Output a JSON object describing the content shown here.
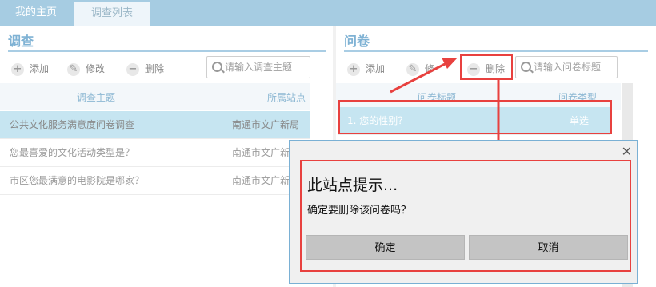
{
  "tabs": [
    {
      "label": "我的主页"
    },
    {
      "label": "调查列表"
    }
  ],
  "left": {
    "title": "调查",
    "toolbar": {
      "add": "添加",
      "edit": "修改",
      "delete": "删除"
    },
    "search": {
      "placeholder": "请输入调查主题"
    },
    "columns": [
      "调查主题",
      "所属站点"
    ],
    "rows": [
      {
        "subject": "公共文化服务满意度问卷调查",
        "site": "南通市文广新局"
      },
      {
        "subject": "您最喜爱的文化活动类型是？",
        "site": "南通市文广新局"
      },
      {
        "subject": "市区您最满意的电影院是哪家？",
        "site": "南通市文广新局"
      }
    ]
  },
  "right": {
    "title": "问卷",
    "toolbar": {
      "add": "添加",
      "edit": "修改",
      "delete": "删除"
    },
    "search": {
      "placeholder": "请输入问卷标题"
    },
    "columns": [
      "问卷标题",
      "问卷类型"
    ],
    "rows": [
      {
        "title": "1. 您的性别？",
        "type": "单选"
      }
    ]
  },
  "dialog": {
    "title": "此站点提示...",
    "message": "确定要删除该问卷吗？",
    "ok": "确定",
    "cancel": "取消"
  },
  "colors": {
    "accent": "#a6cce2",
    "selected_row": "#c6e5f1",
    "annotation": "#e8413f"
  }
}
